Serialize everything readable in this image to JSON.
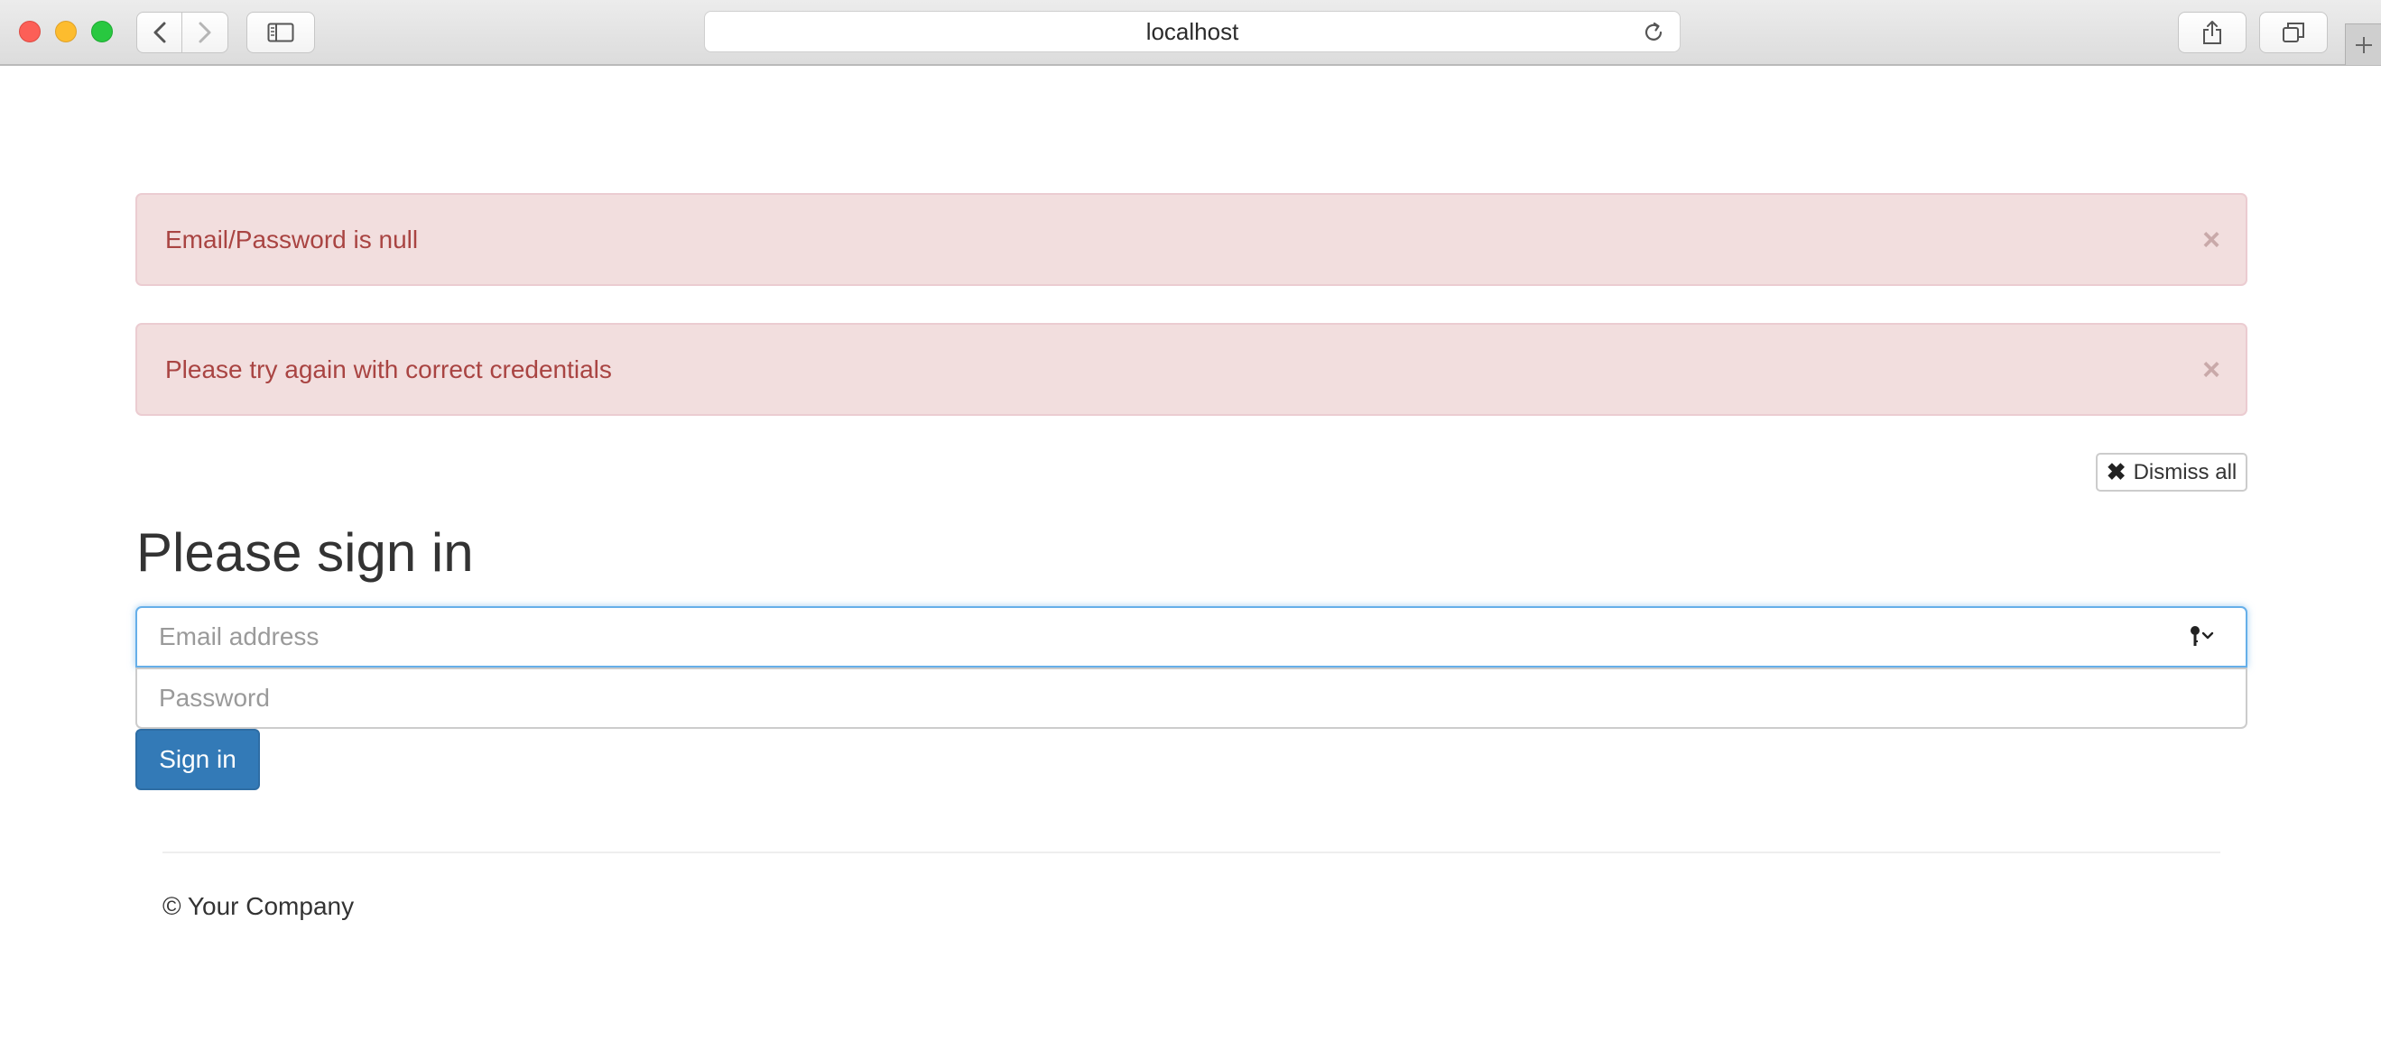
{
  "browser": {
    "url": "localhost"
  },
  "alerts": [
    {
      "message": "Email/Password is null",
      "close_glyph": "×"
    },
    {
      "message": "Please try again with correct credentials",
      "close_glyph": "×"
    }
  ],
  "dismiss_all": {
    "icon": "✖",
    "label": "Dismiss all"
  },
  "form": {
    "heading": "Please sign in",
    "email_placeholder": "Email address",
    "password_placeholder": "Password",
    "submit_label": "Sign in"
  },
  "footer": {
    "text": "© Your Company"
  },
  "colors": {
    "alert_bg": "#f2dede",
    "alert_text": "#a94442",
    "primary": "#337ab7",
    "focus": "#66afe9"
  }
}
